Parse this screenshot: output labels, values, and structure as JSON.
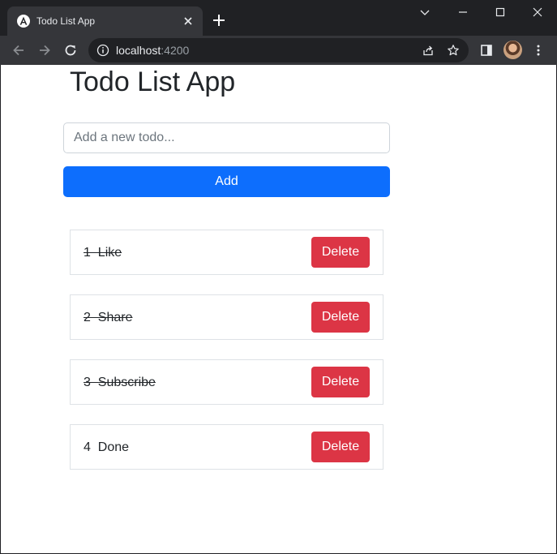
{
  "browser": {
    "tab": {
      "title": "Todo List App",
      "favicon": "angular-logo-icon"
    },
    "url": {
      "host": "localhost",
      "port": ":4200"
    },
    "colors": {
      "tabstrip": "#202124",
      "toolbar": "#35363a",
      "omnibox": "#202124"
    }
  },
  "app": {
    "title": "Todo List App",
    "input": {
      "placeholder": "Add a new todo...",
      "value": ""
    },
    "add_label": "Add",
    "delete_label": "Delete",
    "colors": {
      "primary": "#0d6efd",
      "danger": "#dc3545",
      "text": "#212529"
    },
    "todos": [
      {
        "text": "1  Like",
        "completed": true
      },
      {
        "text": "2  Share",
        "completed": true
      },
      {
        "text": "3  Subscribe",
        "completed": true
      },
      {
        "text": "4  Done",
        "completed": false
      }
    ]
  }
}
